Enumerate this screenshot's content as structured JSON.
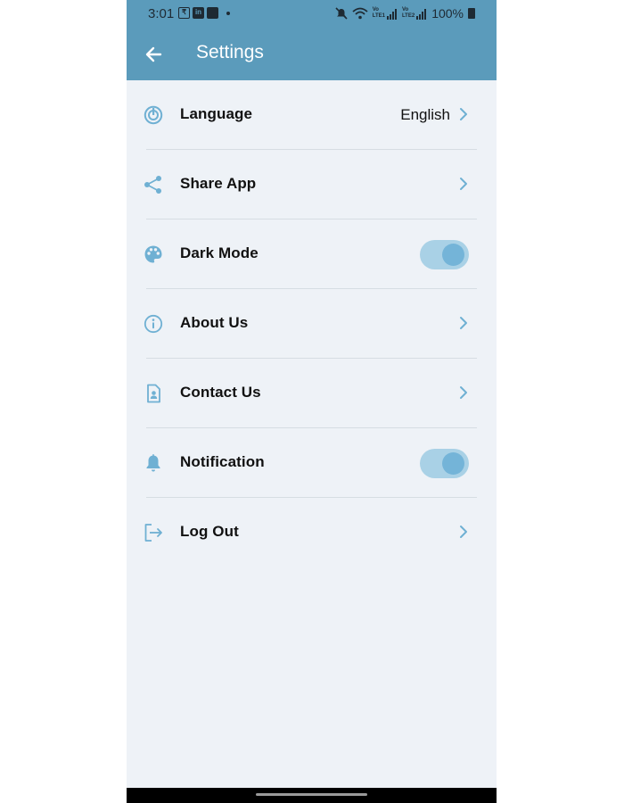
{
  "status_bar": {
    "time": "3:01",
    "left_icons": [
      "rupee-icon",
      "linkedin-icon",
      "briefcase-icon",
      "dot-icon"
    ],
    "right_icons": [
      "mute-icon",
      "wifi-icon",
      "lte1-signal-icon",
      "lte2-signal-icon",
      "battery-icon"
    ],
    "volte1": "Vo",
    "lte1": "LTE1",
    "volte2": "Vo",
    "lte2": "LTE2",
    "battery": "100%"
  },
  "app_bar": {
    "title": "Settings",
    "back_icon": "arrow-left-icon"
  },
  "colors": {
    "accent": "#5b9bbb",
    "icon": "#6fb0d3",
    "toggle_track": "#a9d1e6",
    "toggle_knob": "#74b4d8",
    "background": "#eef2f7"
  },
  "settings": [
    {
      "label": "Language",
      "icon": "language-icon",
      "value": "English",
      "control": "chevron"
    },
    {
      "label": "Share App",
      "icon": "share-icon",
      "control": "chevron"
    },
    {
      "label": "Dark Mode",
      "icon": "palette-icon",
      "control": "toggle",
      "enabled": true
    },
    {
      "label": "About Us",
      "icon": "info-icon",
      "control": "chevron"
    },
    {
      "label": "Contact Us",
      "icon": "contact-icon",
      "control": "chevron"
    },
    {
      "label": "Notification",
      "icon": "bell-icon",
      "control": "toggle",
      "enabled": true
    },
    {
      "label": "Log Out",
      "icon": "logout-icon",
      "control": "chevron"
    }
  ]
}
